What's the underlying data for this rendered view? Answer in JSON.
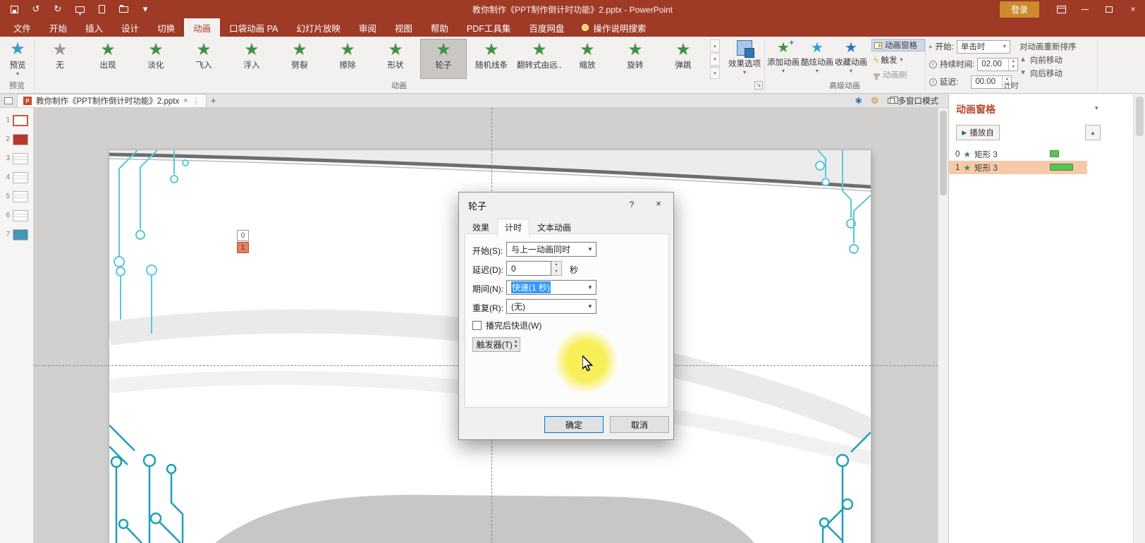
{
  "titlebar": {
    "title": "教你制作《PPT制作倒计时功能》2.pptx  -  PowerPoint",
    "login_label": "登录"
  },
  "tabs": [
    {
      "label": "文件"
    },
    {
      "label": "开始"
    },
    {
      "label": "插入"
    },
    {
      "label": "设计"
    },
    {
      "label": "切换"
    },
    {
      "label": "动画"
    },
    {
      "label": "口袋动画 PA"
    },
    {
      "label": "幻灯片放映"
    },
    {
      "label": "审阅"
    },
    {
      "label": "视图"
    },
    {
      "label": "帮助"
    },
    {
      "label": "PDF工具集"
    },
    {
      "label": "百度网盘"
    }
  ],
  "search_label": "操作说明搜索",
  "ribbon": {
    "preview_label": "预览",
    "gallery": [
      {
        "label": "无"
      },
      {
        "label": "出现"
      },
      {
        "label": "淡化"
      },
      {
        "label": "飞入"
      },
      {
        "label": "浮入"
      },
      {
        "label": "劈裂"
      },
      {
        "label": "擦除"
      },
      {
        "label": "形状"
      },
      {
        "label": "轮子"
      },
      {
        "label": "随机线条"
      },
      {
        "label": "翻转式由远..."
      },
      {
        "label": "缩放"
      },
      {
        "label": "旋转"
      },
      {
        "label": "弹跳"
      }
    ],
    "effect_options_label": "效果选项",
    "add_animation_label": "添加动画",
    "cool_animation_label": "酷炫动画",
    "favorite_animation_label": "收藏动画",
    "animation_pane_label": "动画窗格",
    "trigger_label": "触发",
    "animation_painter_label": "动画刷",
    "timing": {
      "start_label": "开始:",
      "start_value": "单击时",
      "duration_label": "持续时间:",
      "duration_value": "02.00",
      "delay_label": "延迟:",
      "delay_value": "00.00"
    },
    "reorder_label": "对动画重新排序",
    "move_earlier_label": "向前移动",
    "move_later_label": "向后移动",
    "groups": {
      "preview": "预览",
      "animation": "动画",
      "advanced": "高级动画",
      "timing": "计时"
    }
  },
  "docbar": {
    "tab_title": "教你制作《PPT制作倒计时功能》2.pptx",
    "multi_window_label": "多窗口模式"
  },
  "slides": [
    {
      "n": "1"
    },
    {
      "n": "2"
    },
    {
      "n": "3"
    },
    {
      "n": "4"
    },
    {
      "n": "5"
    },
    {
      "n": "6"
    },
    {
      "n": "7"
    }
  ],
  "slide": {
    "counter_top": "0",
    "counter_bottom": "1"
  },
  "dialog": {
    "title": "轮子",
    "tabs": [
      {
        "label": "效果"
      },
      {
        "label": "计时"
      },
      {
        "label": "文本动画"
      }
    ],
    "start_label": "开始(S):",
    "start_value": "与上一动画同时",
    "delay_label": "延迟(D):",
    "delay_value": "0",
    "delay_unit": "秒",
    "period_label": "期间(N):",
    "period_value": "快速(1 秒)",
    "repeat_label": "重复(R):",
    "repeat_value": "(无)",
    "rewind_label": "播完后快退(W)",
    "trigger_button_label": "触发器(T)",
    "ok_label": "确定",
    "cancel_label": "取消"
  },
  "pane": {
    "title": "动画窗格",
    "play_label": "播放自",
    "items": [
      {
        "index": "0",
        "name": "矩形 3"
      },
      {
        "index": "1",
        "name": "矩形 3"
      }
    ]
  },
  "icons": {
    "undo": "↺",
    "redo": "↻",
    "caret": "▾",
    "close": "×",
    "help": "?",
    "star": "★",
    "play": "▶",
    "tri_right": "▸",
    "up": "▲",
    "down": "▼",
    "scroll_up": "▴",
    "scroll_down": "▾",
    "bolt": "ϟ",
    "launcher": "↘",
    "plus": "+",
    "kebab": "⋮",
    "gear": "⚙",
    "plugin": "✱",
    "ppt": "P",
    "collapse": "▴"
  }
}
